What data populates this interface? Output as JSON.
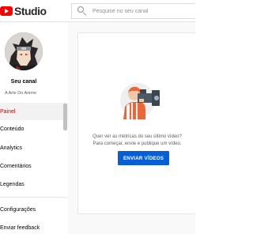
{
  "header": {
    "logo_text": "Studio",
    "search_placeholder": "Pesquise no seu canal"
  },
  "sidebar": {
    "channel_title": "Seu canal",
    "channel_name": "A Arte Do Anime",
    "items": [
      {
        "label": "Painel",
        "active": true
      },
      {
        "label": "Conteúdo",
        "active": false
      },
      {
        "label": "Analytics",
        "active": false
      },
      {
        "label": "Comentários",
        "active": false
      },
      {
        "label": "Legendas",
        "active": false
      }
    ],
    "footer_items": [
      {
        "label": "Configurações"
      },
      {
        "label": "Enviar feedback"
      }
    ]
  },
  "main": {
    "message_line1": "Quer ver as métricas do seu último vídeo?",
    "message_line2": "Para começar, envie e publique um vídeo.",
    "cta_label": "ENVIAR VÍDEOS"
  },
  "colors": {
    "accent": "#065fd4",
    "active": "#cc0000",
    "brand": "#ff0000"
  }
}
